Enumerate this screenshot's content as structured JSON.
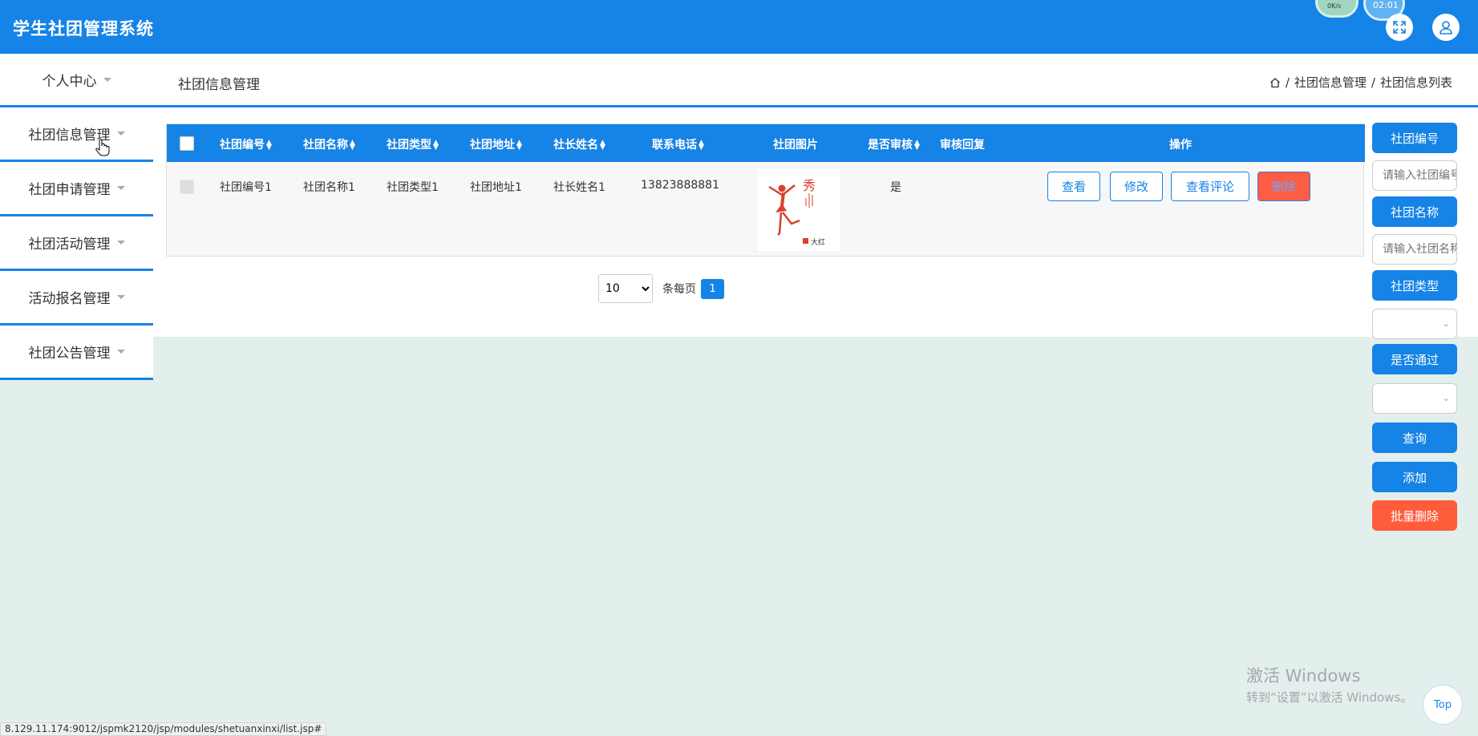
{
  "app": {
    "title": "学生社团管理系统"
  },
  "header": {
    "speed_text": "0K/s",
    "clock_text": "02:01"
  },
  "sidebar": {
    "items": [
      {
        "label": "个人中心"
      },
      {
        "label": "社团信息管理"
      },
      {
        "label": "社团申请管理"
      },
      {
        "label": "社团活动管理"
      },
      {
        "label": "活动报名管理"
      },
      {
        "label": "社团公告管理"
      }
    ]
  },
  "page": {
    "title": "社团信息管理",
    "breadcrumb": [
      "社团信息管理",
      "社团信息列表"
    ],
    "breadcrumb_sep": "/"
  },
  "table": {
    "columns": [
      "社团编号",
      "社团名称",
      "社团类型",
      "社团地址",
      "社长姓名",
      "联系电话",
      "社团图片",
      "是否审核",
      "审核回复",
      "操作"
    ],
    "rows": [
      {
        "code": "社团编号1",
        "name": "社团名称1",
        "type": "社团类型1",
        "address": "社团地址1",
        "leader": "社长姓名1",
        "phone": "13823888881",
        "image_caption": "大红",
        "reviewed": "是",
        "reply": "",
        "actions": [
          "查看",
          "修改",
          "查看评论",
          "删除"
        ]
      }
    ]
  },
  "pagination": {
    "page_size": "10",
    "per_page_label": "条每页",
    "current_page": "1"
  },
  "search_panel": {
    "code_label": "社团编号",
    "code_placeholder": "请输入社团编号",
    "name_label": "社团名称",
    "name_placeholder": "请输入社团名称",
    "type_label": "社团类型",
    "pass_label": "是否通过",
    "query_button": "查询",
    "add_button": "添加",
    "batch_delete_button": "批量删除"
  },
  "watermark": {
    "line1": "激活 Windows",
    "line2": "转到“设置”以激活 Windows。"
  },
  "top_button": "Top",
  "status_bar": "8.129.11.174:9012/jspmk2120/jsp/modules/shetuanxinxi/list.jsp#",
  "colors": {
    "primary": "#1683e6",
    "danger": "#ff5c3c",
    "background": "#e3efec"
  }
}
